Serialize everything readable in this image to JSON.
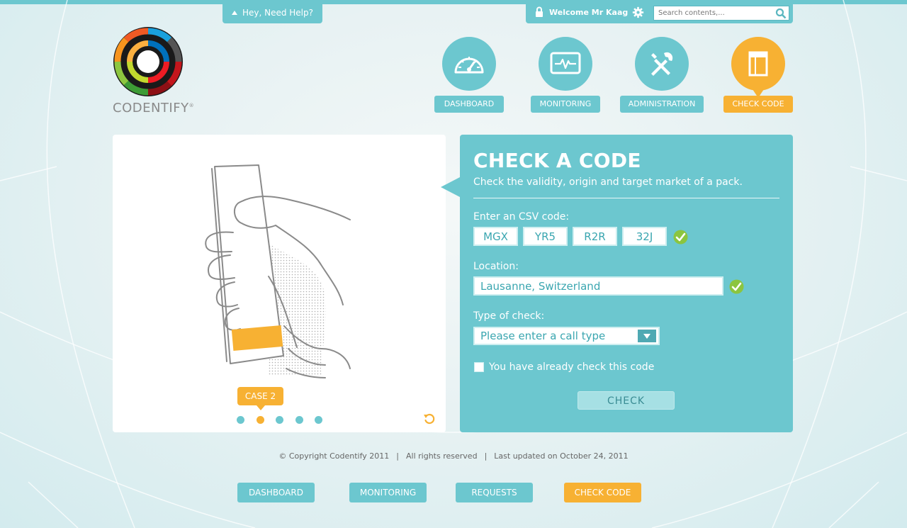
{
  "colors": {
    "teal": "#6cc7cf",
    "orange": "#f7b133",
    "valid_green": "#8bc53f",
    "panel_white": "#ffffff"
  },
  "help": {
    "label": "Hey, Need Help?"
  },
  "userbar": {
    "welcome": "Welcome Mr Kaag",
    "search_placeholder": "Search contents,...",
    "icons": [
      "lock-icon",
      "gear-icon",
      "search-icon"
    ]
  },
  "logo": {
    "text": "CODENTIFY",
    "mark": "®"
  },
  "nav": {
    "items": [
      {
        "label": "DASHBOARD",
        "icon": "speedometer-icon",
        "active": false
      },
      {
        "label": "MONITORING",
        "icon": "monitor-pulse-icon",
        "active": false
      },
      {
        "label": "ADMINISTRATION",
        "icon": "tools-icon",
        "active": false
      },
      {
        "label": "CHECK CODE",
        "icon": "pack-icon",
        "active": true
      }
    ]
  },
  "illustration": {
    "case_label": "CASE 2",
    "dots_count": 5,
    "active_dot": 2,
    "icons": [
      "hand-holding-pack-illustration",
      "refresh-icon"
    ]
  },
  "form": {
    "title": "CHECK A CODE",
    "subtitle": "Check the validity, origin and target market of a pack.",
    "csv_label": "Enter an CSV code:",
    "csv_values": [
      "MGX",
      "YR5",
      "R2R",
      "32J"
    ],
    "csv_valid": true,
    "location_label": "Location:",
    "location_value": "Lausanne, Switzerland",
    "location_valid": true,
    "type_label": "Type of check:",
    "type_value": "Please enter a call type",
    "already_checked_label": "You have already check this code",
    "already_checked": false,
    "check_button": "CHECK"
  },
  "footer": {
    "copyright": "© Copyright Codentify 2011",
    "rights": "All rights reserved",
    "updated": "Last updated on October 24, 2011",
    "separator": "|",
    "links": [
      {
        "label": "DASHBOARD",
        "active": false
      },
      {
        "label": "MONITORING",
        "active": false
      },
      {
        "label": "REQUESTS",
        "active": false
      },
      {
        "label": "CHECK CODE",
        "active": true
      }
    ]
  }
}
